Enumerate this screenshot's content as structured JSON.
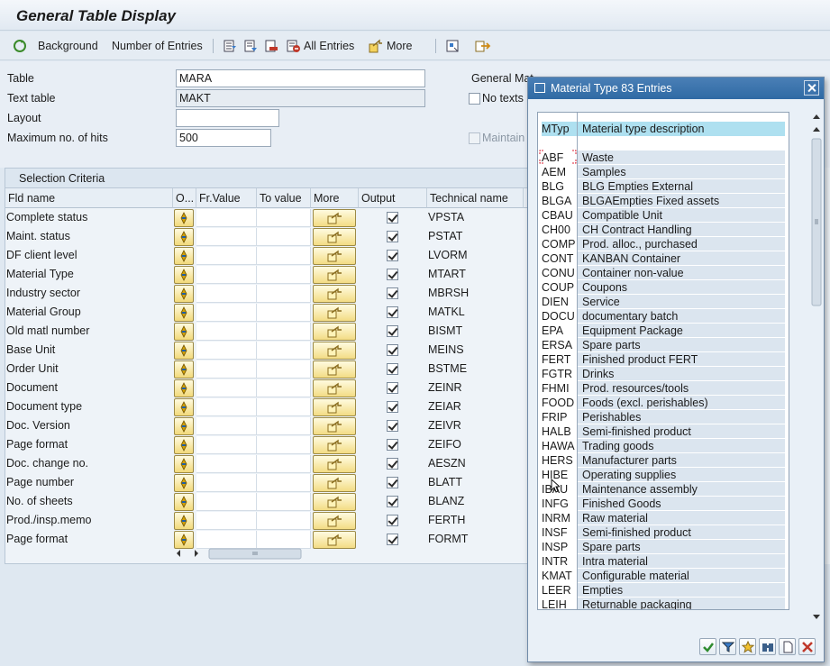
{
  "title": "General Table Display",
  "toolbar": {
    "background": "Background",
    "number_of_entries": "Number of Entries",
    "all_entries": "All Entries",
    "more": "More"
  },
  "form": {
    "table_label": "Table",
    "table_value": "MARA",
    "text_table_label": "Text table",
    "text_table_value": "MAKT",
    "layout_label": "Layout",
    "layout_value": "",
    "max_hits_label": "Maximum no. of hits",
    "max_hits_value": "500",
    "general_label": "General Mat",
    "no_texts_label": "No texts",
    "maintain_label": "Maintain"
  },
  "selection": {
    "title": "Selection Criteria",
    "columns": [
      "Fld name",
      "O...",
      "Fr.Value",
      "To value",
      "More",
      "Output",
      "Technical name"
    ],
    "rows": [
      {
        "name": "Complete status",
        "tech": "VPSTA"
      },
      {
        "name": "Maint. status",
        "tech": "PSTAT"
      },
      {
        "name": "DF client level",
        "tech": "LVORM"
      },
      {
        "name": "Material Type",
        "tech": "MTART"
      },
      {
        "name": "Industry sector",
        "tech": "MBRSH"
      },
      {
        "name": "Material Group",
        "tech": "MATKL"
      },
      {
        "name": "Old matl number",
        "tech": "BISMT"
      },
      {
        "name": "Base Unit",
        "tech": "MEINS"
      },
      {
        "name": "Order Unit",
        "tech": "BSTME"
      },
      {
        "name": "Document",
        "tech": "ZEINR"
      },
      {
        "name": "Document type",
        "tech": "ZEIAR"
      },
      {
        "name": "Doc. Version",
        "tech": "ZEIVR"
      },
      {
        "name": "Page format",
        "tech": "ZEIFO"
      },
      {
        "name": "Doc. change no.",
        "tech": "AESZN"
      },
      {
        "name": "Page number",
        "tech": "BLATT"
      },
      {
        "name": "No. of sheets",
        "tech": "BLANZ"
      },
      {
        "name": "Prod./insp.memo",
        "tech": "FERTH"
      },
      {
        "name": "Page format",
        "tech": "FORMT"
      }
    ]
  },
  "popup": {
    "title": "Material Type 83 Entries",
    "col_key": "MTyp",
    "col_desc": "Material type description",
    "entries": [
      {
        "key": "ABF",
        "desc": "Waste"
      },
      {
        "key": "AEM",
        "desc": "Samples"
      },
      {
        "key": "BLG",
        "desc": "BLG Empties  External"
      },
      {
        "key": "BLGA",
        "desc": "BLGAEmpties  Fixed assets"
      },
      {
        "key": "CBAU",
        "desc": "Compatible Unit"
      },
      {
        "key": "CH00",
        "desc": "CH Contract Handling"
      },
      {
        "key": "COMP",
        "desc": "Prod. alloc., purchased"
      },
      {
        "key": "CONT",
        "desc": "KANBAN Container"
      },
      {
        "key": "CONU",
        "desc": "Container non-value"
      },
      {
        "key": "COUP",
        "desc": "Coupons"
      },
      {
        "key": "DIEN",
        "desc": "Service"
      },
      {
        "key": "DOCU",
        "desc": "documentary batch"
      },
      {
        "key": "EPA",
        "desc": "Equipment Package"
      },
      {
        "key": "ERSA",
        "desc": "Spare parts"
      },
      {
        "key": "FERT",
        "desc": "Finished product FERT"
      },
      {
        "key": "FGTR",
        "desc": "Drinks"
      },
      {
        "key": "FHMI",
        "desc": "Prod. resources/tools"
      },
      {
        "key": "FOOD",
        "desc": "Foods (excl. perishables)"
      },
      {
        "key": "FRIP",
        "desc": "Perishables"
      },
      {
        "key": "HALB",
        "desc": "Semi-finished product"
      },
      {
        "key": "HAWA",
        "desc": "Trading goods"
      },
      {
        "key": "HERS",
        "desc": "Manufacturer parts"
      },
      {
        "key": "HIBE",
        "desc": "Operating supplies"
      },
      {
        "key": "IBAU",
        "desc": "Maintenance assembly"
      },
      {
        "key": "INFG",
        "desc": "Finished Goods"
      },
      {
        "key": "INRM",
        "desc": "Raw material"
      },
      {
        "key": "INSF",
        "desc": "Semi-finished product"
      },
      {
        "key": "INSP",
        "desc": "Spare parts"
      },
      {
        "key": "INTR",
        "desc": "Intra material"
      },
      {
        "key": "KMAT",
        "desc": "Configurable material"
      },
      {
        "key": "LEER",
        "desc": "Empties"
      },
      {
        "key": "LEIH",
        "desc": "Returnable packaging"
      }
    ]
  },
  "colors": {
    "accent": "#2f6aa4",
    "header_highlight": "#aee0f0",
    "button_yellow": "#f3dc84"
  }
}
